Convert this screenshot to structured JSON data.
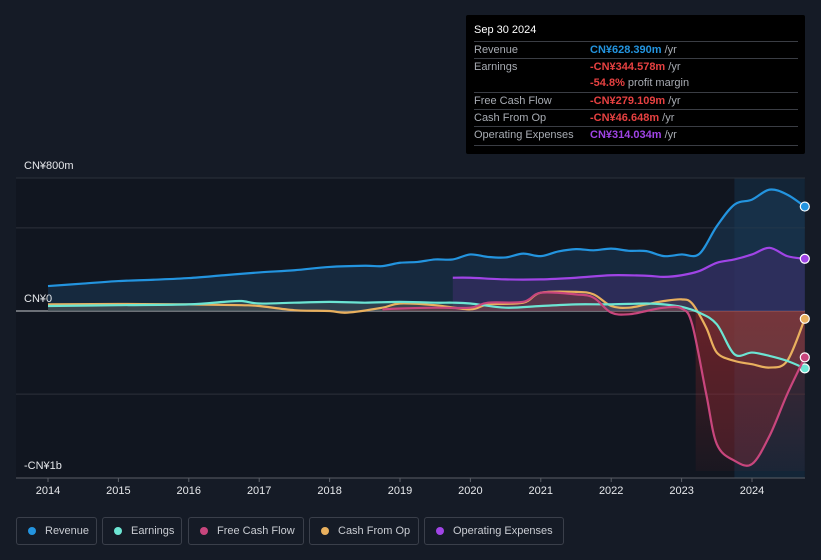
{
  "tooltip": {
    "date": "Sep 30 2024",
    "rows": [
      {
        "label": "Revenue",
        "value": "CN¥628.390m",
        "unit": "/yr",
        "color": "#2394df"
      },
      {
        "label": "Earnings",
        "value": "-CN¥344.578m",
        "unit": "/yr",
        "color": "#e64141"
      },
      {
        "label": "",
        "value": "-54.8%",
        "unit": "profit margin",
        "color": "#e64141"
      },
      {
        "label": "Free Cash Flow",
        "value": "-CN¥279.109m",
        "unit": "/yr",
        "color": "#e64141"
      },
      {
        "label": "Cash From Op",
        "value": "-CN¥46.648m",
        "unit": "/yr",
        "color": "#e64141"
      },
      {
        "label": "Operating Expenses",
        "value": "CN¥314.034m",
        "unit": "/yr",
        "color": "#a044e6"
      }
    ]
  },
  "legend": [
    {
      "label": "Revenue",
      "color": "#2394df"
    },
    {
      "label": "Earnings",
      "color": "#6ce5d3"
    },
    {
      "label": "Free Cash Flow",
      "color": "#c8467d"
    },
    {
      "label": "Cash From Op",
      "color": "#e9b05e"
    },
    {
      "label": "Operating Expenses",
      "color": "#a044e6"
    }
  ],
  "chart_data": {
    "type": "line",
    "title": "",
    "xlabel": "",
    "ylabel": "",
    "currency": "CN¥",
    "ylim": [
      -1000,
      800
    ],
    "y_tick_labels": [
      {
        "value": 800,
        "label": "CN¥800m"
      },
      {
        "value": 0,
        "label": "CN¥0"
      },
      {
        "value": -1000,
        "label": "-CN¥1b"
      }
    ],
    "gridlines_m": [
      800,
      500,
      0,
      -500
    ],
    "x_tick_labels": [
      "2014",
      "2015",
      "2016",
      "2017",
      "2018",
      "2019",
      "2020",
      "2021",
      "2022",
      "2023",
      "2024"
    ],
    "xlim": [
      2014,
      2024.75
    ],
    "highlight_region_start": 2023.75,
    "grid": true,
    "legend_position": "bottom-left",
    "series": [
      {
        "name": "Revenue",
        "color": "#2394df",
        "x": [
          2014,
          2014.5,
          2015,
          2015.5,
          2016,
          2016.5,
          2017,
          2017.5,
          2018,
          2018.5,
          2018.75,
          2019,
          2019.25,
          2019.5,
          2019.75,
          2020,
          2020.25,
          2020.5,
          2020.75,
          2021,
          2021.25,
          2021.5,
          2021.75,
          2022,
          2022.25,
          2022.5,
          2022.75,
          2023,
          2023.25,
          2023.5,
          2023.75,
          2024,
          2024.25,
          2024.5,
          2024.75
        ],
        "values": [
          150,
          165,
          180,
          188,
          198,
          215,
          232,
          245,
          265,
          272,
          270,
          290,
          295,
          310,
          310,
          340,
          325,
          322,
          345,
          330,
          358,
          372,
          365,
          375,
          362,
          360,
          330,
          340,
          343,
          510,
          640,
          670,
          730,
          700,
          628
        ]
      },
      {
        "name": "Earnings",
        "color": "#6ce5d3",
        "x": [
          2014,
          2015,
          2016,
          2016.5,
          2016.75,
          2017,
          2017.5,
          2018,
          2018.5,
          2019,
          2019.5,
          2019.75,
          2020,
          2020.5,
          2021,
          2021.5,
          2022,
          2022.5,
          2022.75,
          2023,
          2023.25,
          2023.5,
          2023.75,
          2024,
          2024.25,
          2024.5,
          2024.75
        ],
        "values": [
          30,
          35,
          40,
          55,
          60,
          45,
          50,
          55,
          50,
          55,
          50,
          50,
          45,
          20,
          30,
          40,
          40,
          45,
          40,
          25,
          -10,
          -80,
          -260,
          -250,
          -270,
          -300,
          -345
        ]
      },
      {
        "name": "Free Cash Flow",
        "color": "#c8467d",
        "x": [
          2018.75,
          2019,
          2019.5,
          2020,
          2020.25,
          2020.75,
          2021,
          2021.5,
          2021.75,
          2022,
          2022.25,
          2022.5,
          2022.75,
          2023,
          2023.15,
          2023.35,
          2023.5,
          2023.75,
          2024,
          2024.25,
          2024.5,
          2024.75
        ],
        "values": [
          10,
          15,
          20,
          20,
          50,
          55,
          110,
          100,
          80,
          -10,
          -20,
          0,
          20,
          15,
          -80,
          -500,
          -800,
          -900,
          -920,
          -750,
          -500,
          -279
        ]
      },
      {
        "name": "Cash From Op",
        "color": "#e9b05e",
        "x": [
          2014,
          2015,
          2016,
          2016.75,
          2017,
          2017.5,
          2018,
          2018.25,
          2018.75,
          2019,
          2019.5,
          2020,
          2020.25,
          2020.75,
          2021,
          2021.5,
          2021.75,
          2022,
          2022.25,
          2022.5,
          2022.75,
          2023,
          2023.15,
          2023.35,
          2023.5,
          2023.75,
          2024,
          2024.25,
          2024.5,
          2024.75
        ],
        "values": [
          40,
          42,
          40,
          35,
          30,
          5,
          0,
          -10,
          20,
          45,
          35,
          10,
          40,
          50,
          110,
          115,
          100,
          30,
          20,
          40,
          60,
          70,
          45,
          -100,
          -250,
          -300,
          -320,
          -340,
          -300,
          -47
        ]
      },
      {
        "name": "Operating Expenses",
        "color": "#a044e6",
        "x": [
          2019.75,
          2020,
          2020.5,
          2021,
          2021.5,
          2022,
          2022.5,
          2022.75,
          2023,
          2023.25,
          2023.5,
          2023.75,
          2024,
          2024.25,
          2024.5,
          2024.75
        ],
        "values": [
          200,
          200,
          190,
          190,
          200,
          215,
          212,
          205,
          215,
          240,
          290,
          310,
          340,
          380,
          330,
          314
        ]
      }
    ]
  }
}
